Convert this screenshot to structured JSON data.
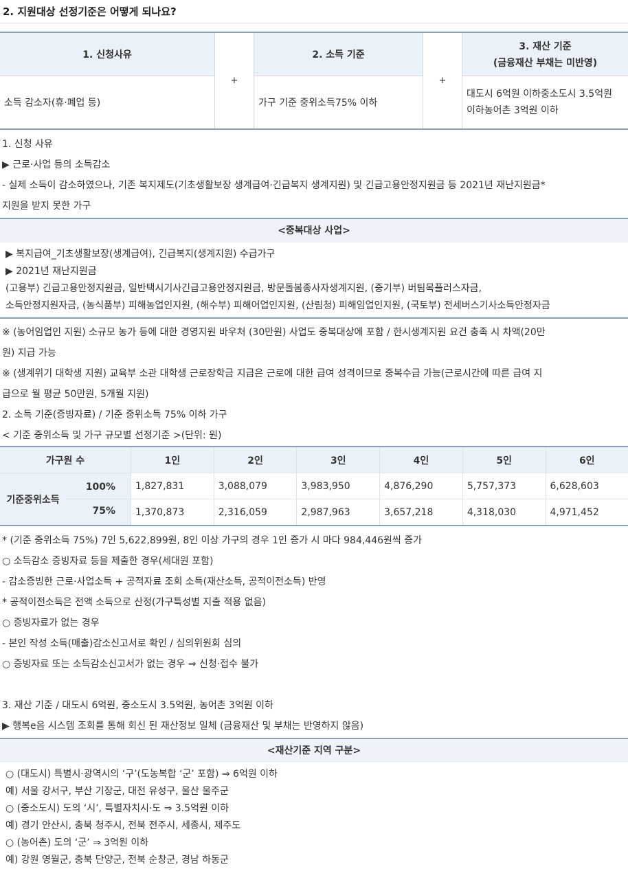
{
  "section_title": "2. 지원대상 선정기준은 어떻게 되나요?",
  "criteria": {
    "plus": "+",
    "reason_head": "1. 신청사유",
    "reason_value": "소득 감소자(휴·폐업 등)",
    "income_head": "2. 소득 기준",
    "income_value": "가구 기준 중위소득75% 이하",
    "asset_head_1": "3. 재산 기준",
    "asset_head_2": "(금융재산 부채는 미반영)",
    "asset_value_1": "대도시 6억원 이하중소도시 3.5억원",
    "asset_value_2": "이하농어촌 3억원 이하"
  },
  "reason_lines": [
    "1. 신청 사유",
    "▶ 근로·사업 등의 소득감소",
    "- 실제 소득이 감소하였으나, 기존 복지제도(기초생활보장 생계급여·긴급복지 생계지원) 및 긴급고용안정지원금 등 2021년 재난지원금*",
    "지원을 받지 못한 가구"
  ],
  "duplicate_box": {
    "title": "<중복대상 사업>",
    "lines": [
      "▶ 복지급여_기초생활보장(생계급여), 긴급복지(생계지원) 수급가구",
      "▶ 2021년 재난지원금",
      "(고용부) 긴급고용안정지원금, 일반택시기사긴급고용안정지원금, 방문돌봄종사자생계지원, (중기부) 버팀목플러스자금,",
      "소득안정지원자금, (농식품부) 피해농업인지원, (해수부) 피해어업인지원, (산림청) 피해임업인지원, (국토부) 전세버스기사소득안정자금"
    ]
  },
  "notes_lines": [
    "※ (농어임업인 지원) 소규모 농가 등에 대한 경영지원 바우처 (30만원) 사업도 중복대상에 포함 / 한시생계지원 요건 충족 시 차액(20만",
    "원) 지급 가능",
    "※ (생계위기 대학생 지원) 교육부 소관 대학생 근로장학금 지급은 근로에 대한 급여 성격이므로 중복수급 가능(근로시간에 따른 급여 지",
    "급으로 월 평균 50만원, 5개월 지원)",
    "2. 소득 기준(증빙자료) / 기준 중위소득 75% 이하 가구",
    "< 기준 중위소득 및 가구 규모별 선정기준 >(단위: 원)"
  ],
  "income_table": {
    "header": [
      "가구원 수",
      "1인",
      "2인",
      "3인",
      "4인",
      "5인",
      "6인"
    ],
    "row_label": "기준중위소득",
    "rows": [
      {
        "pct": "100%",
        "values": [
          "1,827,831",
          "3,088,079",
          "3,983,950",
          "4,876,290",
          "5,757,373",
          "6,628,603"
        ]
      },
      {
        "pct": "75%",
        "values": [
          "1,370,873",
          "2,316,059",
          "2,987,963",
          "3,657,218",
          "4,318,030",
          "4,971,452"
        ]
      }
    ]
  },
  "after_table_lines": [
    "* (기준 중위소득 75%) 7인 5,622,899원, 8인 이상 가구의 경우 1인 증가 시 마다 984,446원씩 증가",
    "○ 소득감소 증빙자료 등을 제출한 경우(세대원 포함)",
    "- 감소증빙한 근로·사업소득 + 공적자료 조회 소득(재산소득, 공적이전소득) 반영",
    "* 공적이전소득은 전액 소득으로 산정(가구특성별 지출 적용 없음)",
    "○ 증빙자료가 없는 경우",
    "- 본인 작성 소득(매출)감소신고서로 확인 / 심의위원회 심의",
    "○ 증빙자료 또는 소득감소신고서가 없는 경우 ⇒ 신청·접수 불가"
  ],
  "asset_lines": [
    "3. 재산 기준 / 대도시 6억원, 중소도시 3.5억원, 농어촌 3억원 이하",
    "▶ 행복e음 시스템 조회를 통해 회신 된 재산정보 일체 (금융재산 및 부채는 반영하지 않음)"
  ],
  "region_box": {
    "title": "<재산기준 지역 구분>",
    "lines": [
      "○ (대도시) 특별시·광역시의 ‘구’(도농복합 ‘군’ 포함) ⇒ 6억원 이하",
      "예) 서울 강서구, 부산 기장군, 대전 유성구, 울산 울주군",
      "○ (중소도시) 도의 ‘시’, 특별자치시·도 ⇒ 3.5억원 이하",
      "예) 경기 안산시, 충북 청주시, 전북 전주시, 세종시, 제주도",
      "○ (농어촌) 도의 ‘군’ ⇒ 3억원 이하",
      "예) 강원 영월군, 충북 단양군, 전북 순창군, 경남 하동군"
    ]
  }
}
